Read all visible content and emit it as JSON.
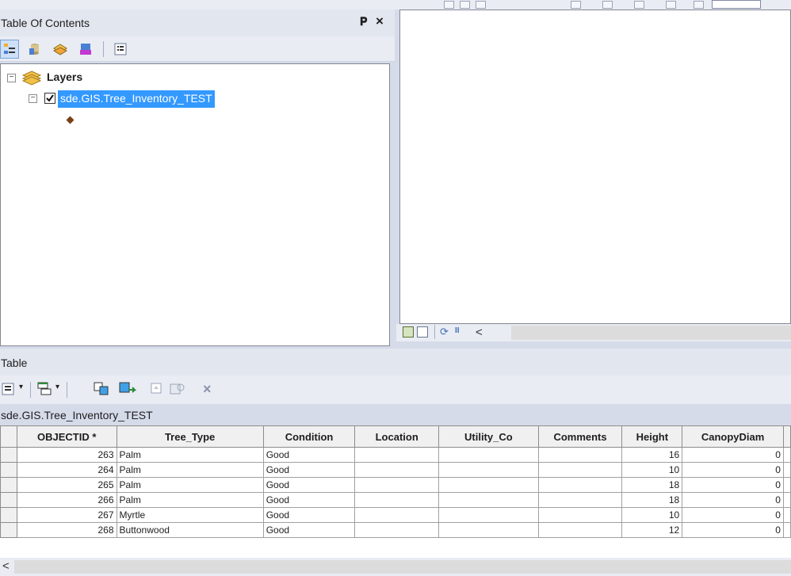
{
  "toc": {
    "title": "Table Of Contents",
    "pin_icon": "pin-icon",
    "close_icon": "close-icon",
    "tools": [
      "list-by-drawing-order-icon",
      "list-by-source-icon",
      "list-by-visibility-icon",
      "list-by-selection-icon",
      "options-icon"
    ],
    "tree": {
      "root_label": "Layers",
      "layer_label": "sde.GIS.Tree_Inventory_TEST",
      "layer_checked": true
    }
  },
  "map": {
    "bottom_tools": [
      "data-view-icon",
      "layout-view-icon",
      "refresh-icon",
      "pause-icon",
      "scroll-left-icon"
    ],
    "scroll_left": "<"
  },
  "table": {
    "title": "Table",
    "tab_label": "sde.GIS.Tree_Inventory_TEST",
    "tools": [
      "table-options-icon",
      "related-tables-icon",
      "select-by-attributes-icon",
      "switch-selection-icon",
      "clear-selection-icon",
      "zoom-to-selected-icon",
      "delete-selected-icon"
    ],
    "columns": [
      "OBJECTID *",
      "Tree_Type",
      "Condition",
      "Location",
      "Utility_Co",
      "Comments",
      "Height",
      "CanopyDiam"
    ],
    "rows": [
      [
        "263",
        "Palm",
        "Good",
        "",
        "",
        "",
        "16",
        "0"
      ],
      [
        "264",
        "Palm",
        "Good",
        "",
        "",
        "",
        "10",
        "0"
      ],
      [
        "265",
        "Palm",
        "Good",
        "",
        "",
        "",
        "18",
        "0"
      ],
      [
        "266",
        "Palm",
        "Good",
        "",
        "",
        "",
        "18",
        "0"
      ],
      [
        "267",
        "Myrtle",
        "Good",
        "",
        "",
        "",
        "10",
        "0"
      ],
      [
        "268",
        "Buttonwood",
        "Good",
        "",
        "",
        "",
        "12",
        "0"
      ]
    ],
    "scroll_left": "<"
  },
  "colors": {
    "selection": "#3399ff",
    "panel": "#d6dbe9",
    "title_bar": "#e2e6ef"
  }
}
